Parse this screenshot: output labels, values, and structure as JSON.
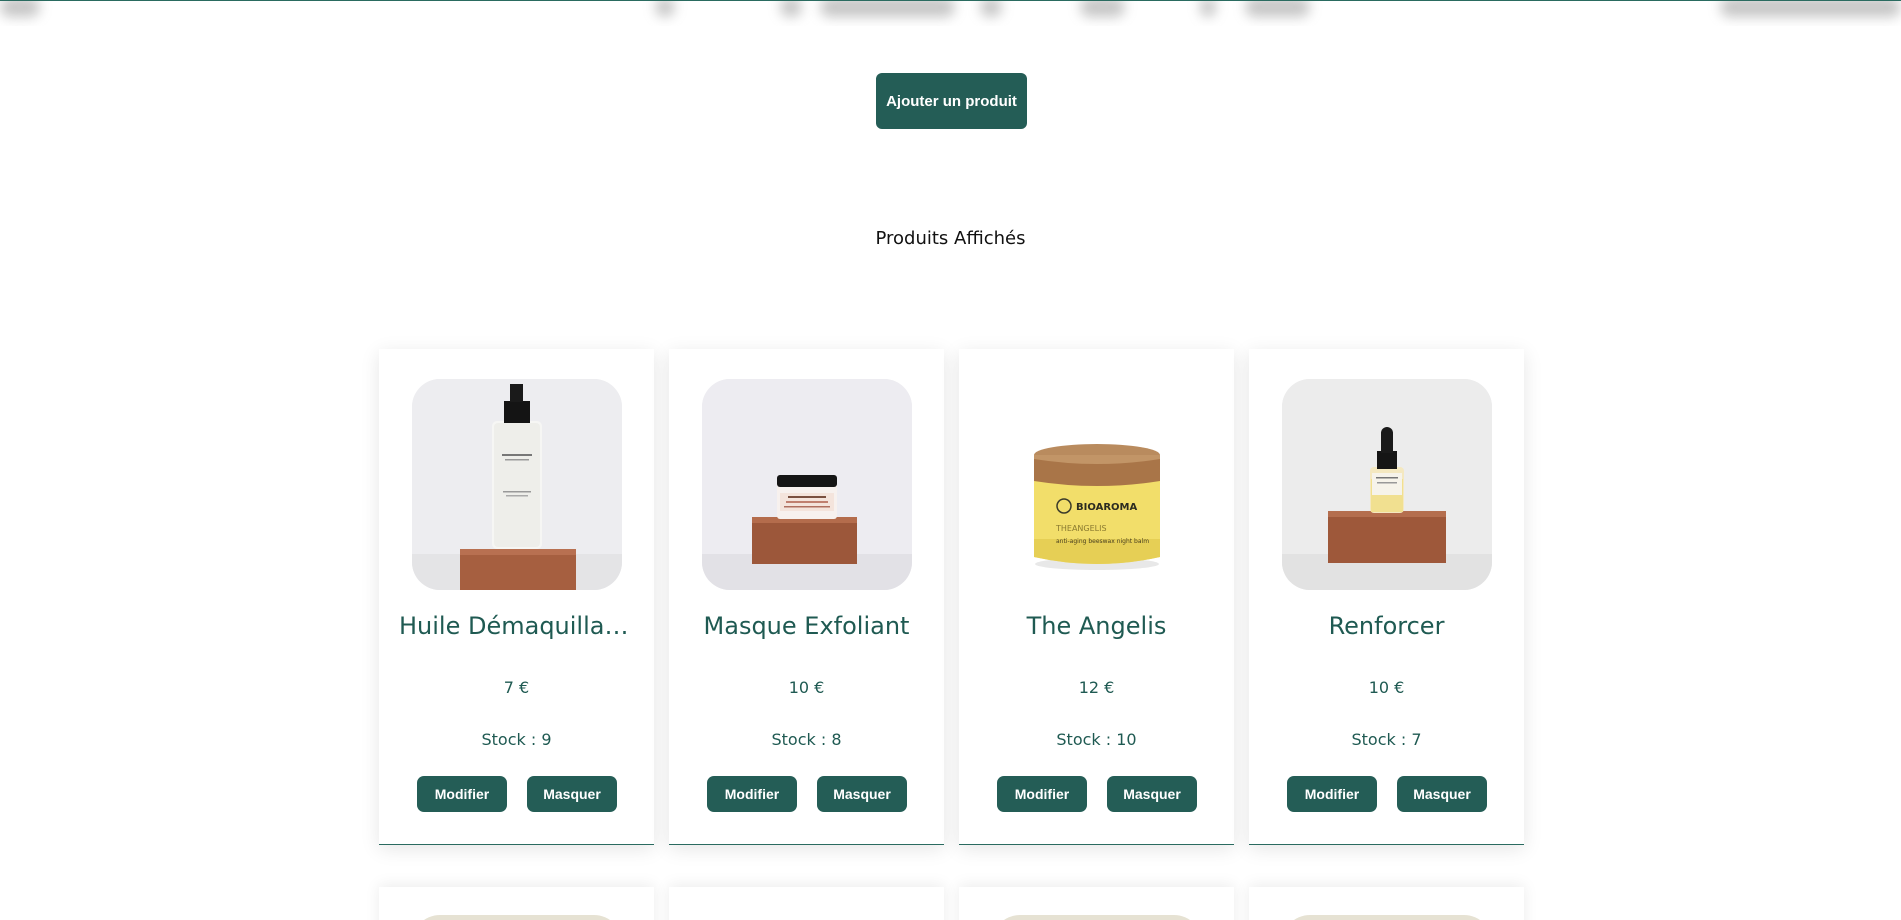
{
  "toolbar": {
    "add_label": "Ajouter un produit"
  },
  "section": {
    "title": "Produits Affichés"
  },
  "products": [
    {
      "name": "Huile Démaquillante",
      "price": "7 €",
      "stock": "Stock : 9",
      "edit_label": "Modifier",
      "hide_label": "Masquer",
      "image": "oil-bottle-on-wood-image"
    },
    {
      "name": "Masque Exfoliant",
      "price": "10 €",
      "stock": "Stock : 8",
      "edit_label": "Modifier",
      "hide_label": "Masquer",
      "image": "jar-on-wood-image"
    },
    {
      "name": "The Angelis",
      "price": "12 €",
      "stock": "Stock : 10",
      "edit_label": "Modifier",
      "hide_label": "Masquer",
      "image": "bioaroma-balm-jar-image"
    },
    {
      "name": "Renforcer",
      "price": "10 €",
      "stock": "Stock : 7",
      "edit_label": "Modifier",
      "hide_label": "Masquer",
      "image": "dropper-bottle-on-wood-image"
    }
  ],
  "jar_label": {
    "brand": "BIOAROMA",
    "product": "THEANGELIS",
    "subtitle": "anti-aging beeswax night balm"
  },
  "colors": {
    "accent": "#245d56",
    "text": "#1f5a52",
    "wood": "#a0583a",
    "balm_yellow": "#f2de6a"
  }
}
